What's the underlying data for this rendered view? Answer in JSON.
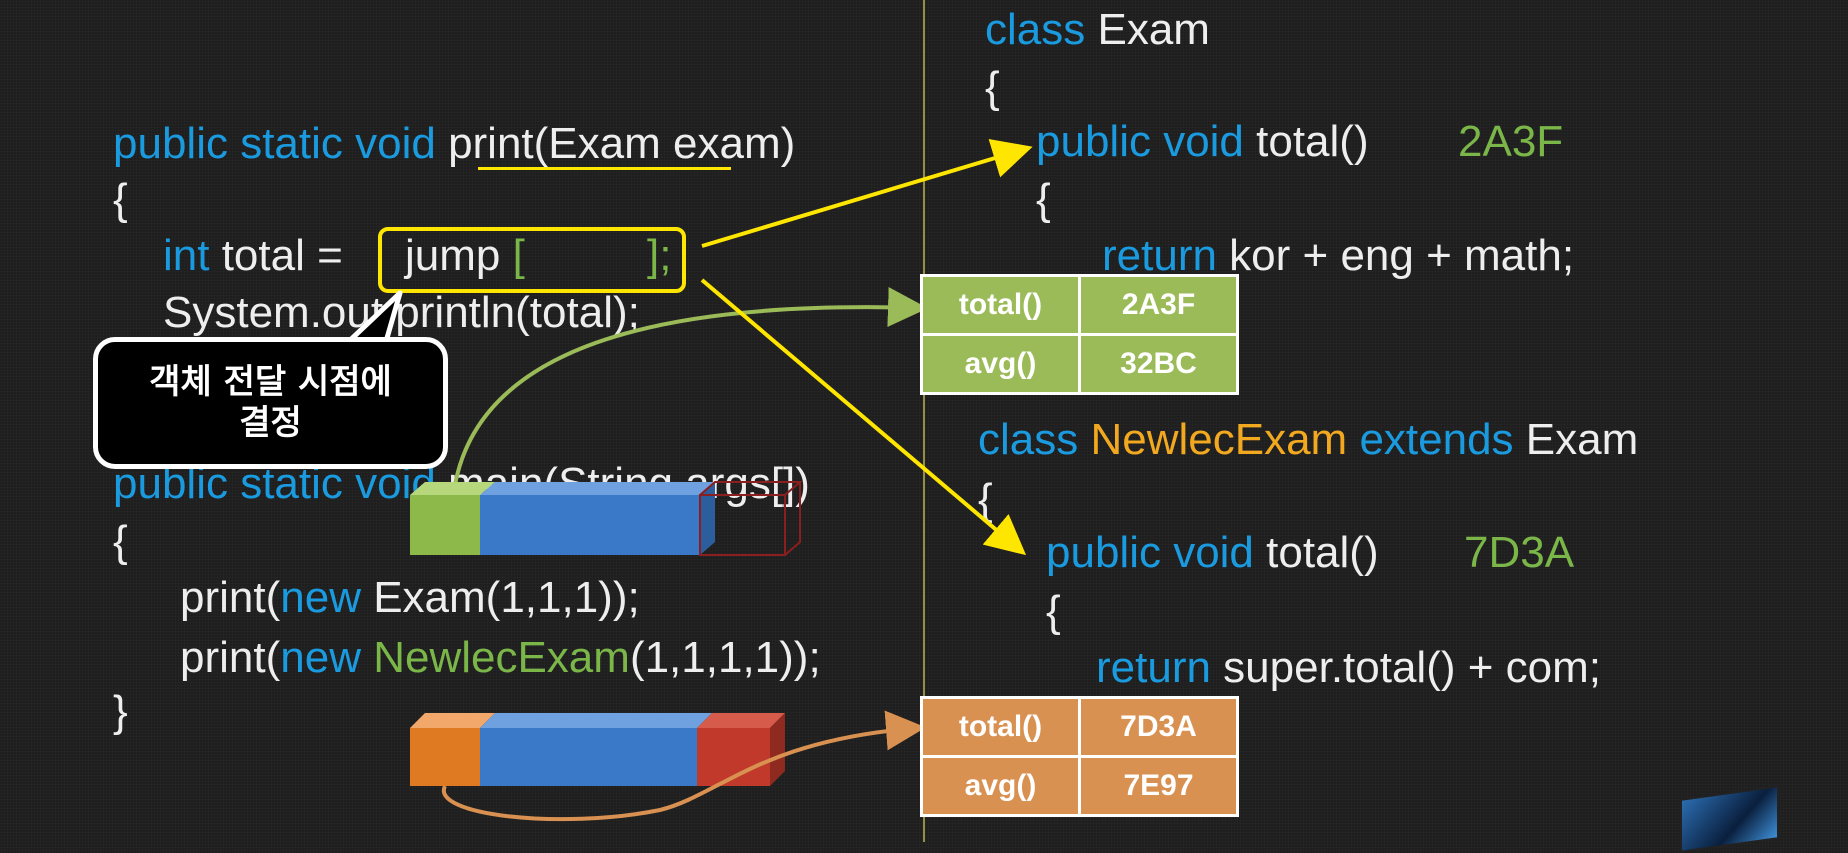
{
  "left_code": {
    "print_signature": {
      "kw": "public static void",
      "name": "print(Exam",
      "param": " exam)"
    },
    "open_brace_1": "{",
    "int_kw": "int",
    "total_assign": " total =",
    "jump_text": "jump",
    "jump_open": "[",
    "jump_close": "];",
    "system_line": "System.out.println(total);",
    "main_signature": {
      "kw": "public static void",
      "rest": " main(String args[])"
    },
    "open_brace_2": "{",
    "print1": {
      "pre": "print(",
      "new_kw": "new",
      "rest": " Exam(1,1,1));"
    },
    "print2": {
      "pre": "print(",
      "new_kw": "new",
      "cls": " NewlecExam",
      "rest": "(1,1,1,1));"
    },
    "close_brace": "}"
  },
  "callout": {
    "line1": "객체 전달 시점에",
    "line2": "결정"
  },
  "right_code": {
    "exam_class": {
      "kw": "class",
      "name": " Exam"
    },
    "open_brace_1": "{",
    "exam_total": {
      "kw": "public void",
      "name": " total()",
      "addr": "2A3F"
    },
    "open_brace_2": "{",
    "exam_return": {
      "kw": "return",
      "rest": " kor + eng + math;"
    },
    "newlec_class": {
      "kw": "class",
      "name": " NewlecExam",
      "ext_kw": " extends",
      "base": " Exam"
    },
    "open_brace_3": "{",
    "newlec_total": {
      "kw": "public void",
      "name": " total()",
      "addr": "7D3A"
    },
    "open_brace_4": "{",
    "newlec_return": {
      "kw": "return",
      "rest": " super.total() + com;"
    }
  },
  "vtable_exam": [
    {
      "method": "total()",
      "addr": "2A3F"
    },
    {
      "method": "avg()",
      "addr": "32BC"
    }
  ],
  "vtable_newlec": [
    {
      "method": "total()",
      "addr": "7D3A"
    },
    {
      "method": "avg()",
      "addr": "7E97"
    }
  ],
  "colors": {
    "background": "#1e1e1e",
    "keyword": "#1a9be0",
    "class_name": "#f2a81f",
    "green": "#7ab648",
    "highlight": "#ffe600",
    "vtable_green": "#9bbb59",
    "vtable_orange": "#d99152",
    "object_blue": "#3a78c8",
    "object_red": "#c0392b"
  }
}
